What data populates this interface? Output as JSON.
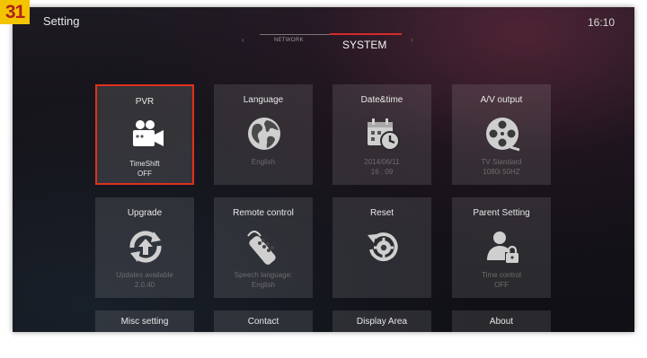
{
  "header": {
    "badge": "31",
    "title": "Setting",
    "clock": "16:10"
  },
  "tabs": {
    "left": "NETWORK",
    "active": "SYSTEM"
  },
  "tiles": [
    {
      "title": "PVR",
      "line1": "TimeShift",
      "line2": "OFF",
      "icon": "video-camera-icon",
      "selected": true
    },
    {
      "title": "Language",
      "line1": "English",
      "line2": "",
      "icon": "globe-icon"
    },
    {
      "title": "Date&time",
      "line1": "2014/06/11",
      "line2": "16 : 09",
      "icon": "calendar-clock-icon"
    },
    {
      "title": "A/V output",
      "line1": "TV Standard",
      "line2": "1080i 50HZ",
      "icon": "film-reel-icon"
    },
    {
      "title": "Upgrade",
      "line1": "Updates available",
      "line2": "2.0.40",
      "icon": "upgrade-arrows-icon"
    },
    {
      "title": "Remote control",
      "line1": "Speech language:",
      "line2": "English",
      "icon": "remote-control-icon"
    },
    {
      "title": "Reset",
      "line1": "",
      "line2": "",
      "icon": "reset-gear-icon"
    },
    {
      "title": "Parent Setting",
      "line1": "Time control",
      "line2": "OFF",
      "icon": "parent-lock-icon"
    },
    {
      "title": "Misc setting"
    },
    {
      "title": "Contact"
    },
    {
      "title": "Display Area"
    },
    {
      "title": "About"
    }
  ],
  "colors": {
    "accent": "#d42a2a",
    "badge_bg": "#f3c400",
    "badge_text": "#b1201d"
  }
}
